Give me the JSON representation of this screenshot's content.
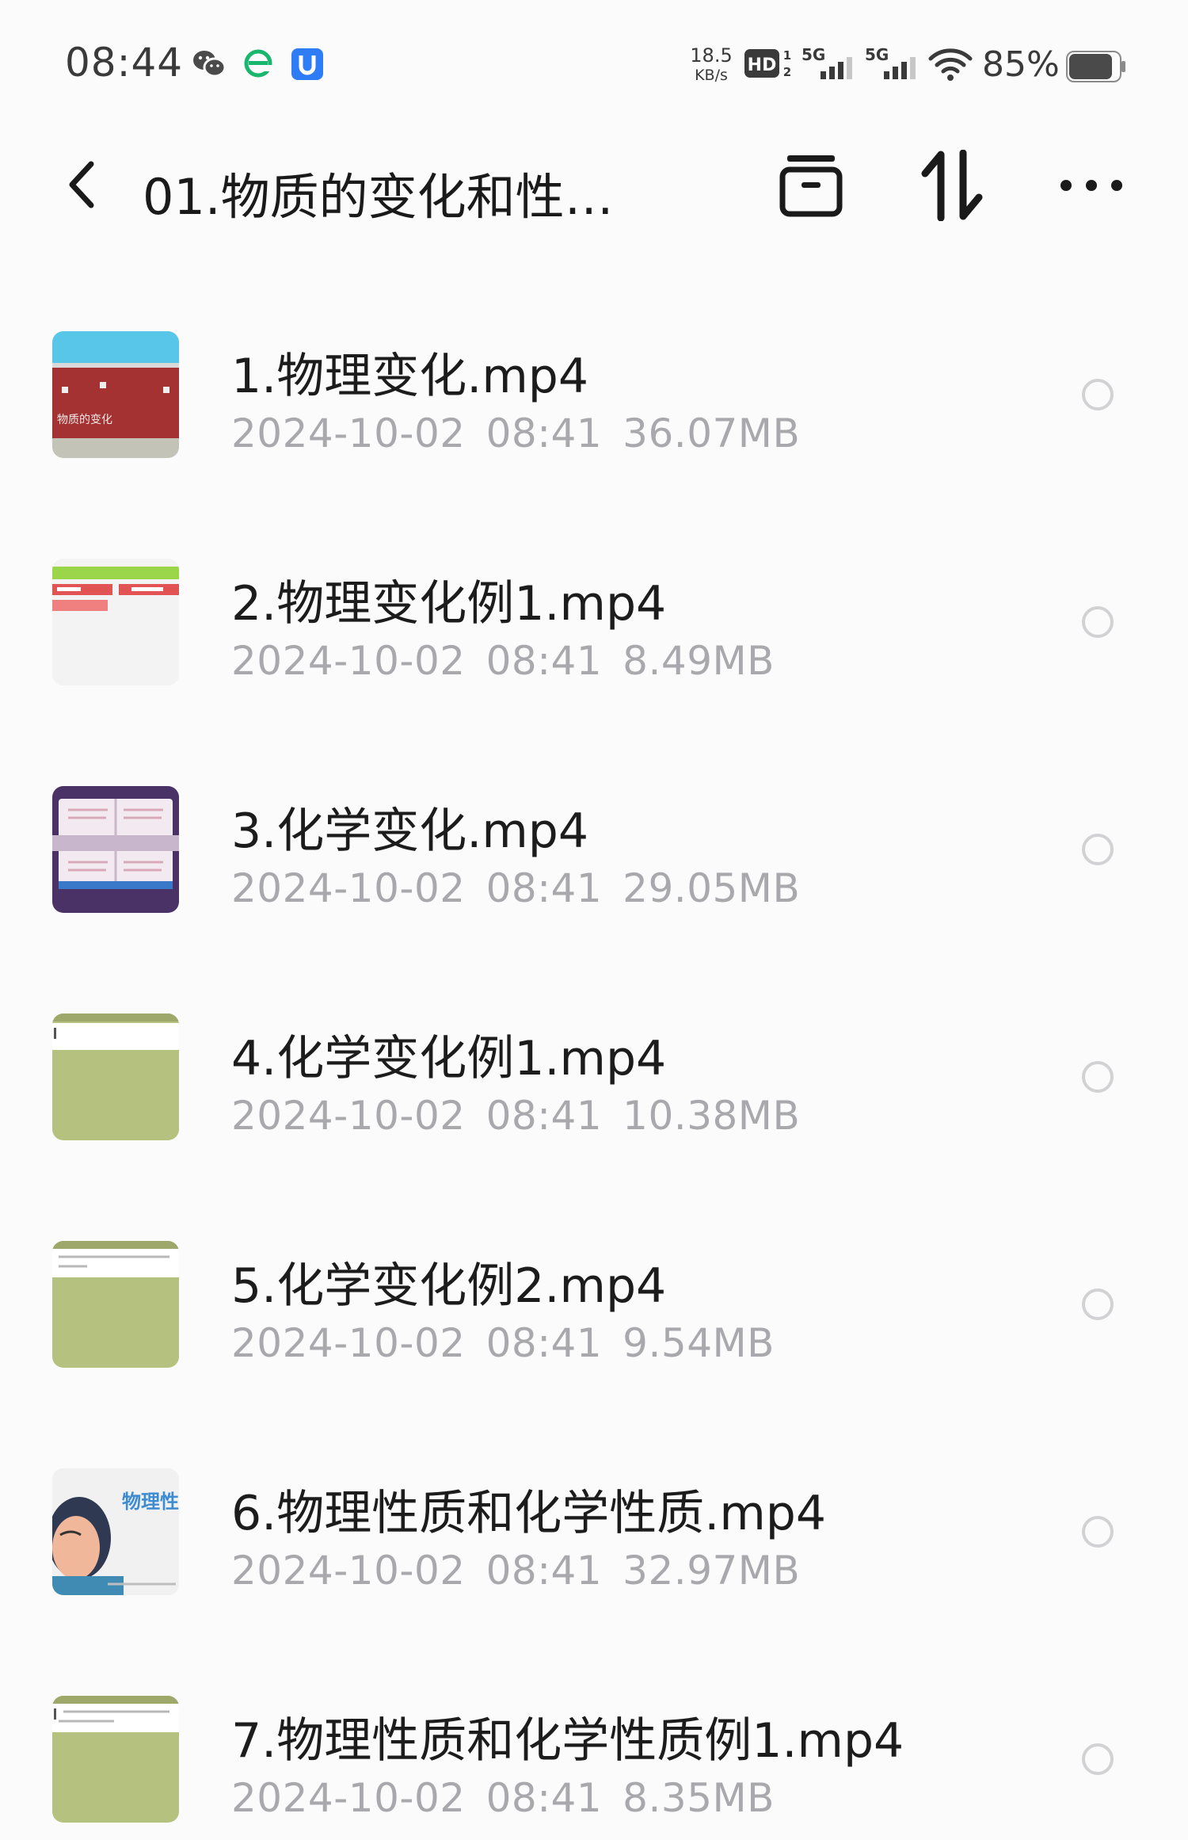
{
  "status_bar": {
    "time": "08:44",
    "net_speed_value": "18.5",
    "net_speed_unit": "KB/s",
    "hd_label": "HD",
    "signal_1_label": "5G",
    "signal_2_label": "5G",
    "battery_percent": "85%",
    "app_icons": [
      "wechat-icon",
      "browser-icon",
      "shield-app-icon"
    ]
  },
  "title_bar": {
    "title": "01.物质的变化和性…",
    "actions": [
      "archive-icon",
      "sort-icon",
      "more-icon"
    ]
  },
  "files": [
    {
      "name": "1.物理变化.mp4",
      "date": "2024-10-02",
      "time": "08:41",
      "size": "36.07MB"
    },
    {
      "name": "2.物理变化例1.mp4",
      "date": "2024-10-02",
      "time": "08:41",
      "size": "8.49MB"
    },
    {
      "name": "3.化学变化.mp4",
      "date": "2024-10-02",
      "time": "08:41",
      "size": "29.05MB"
    },
    {
      "name": "4.化学变化例1.mp4",
      "date": "2024-10-02",
      "time": "08:41",
      "size": "10.38MB"
    },
    {
      "name": "5.化学变化例2.mp4",
      "date": "2024-10-02",
      "time": "08:41",
      "size": "9.54MB"
    },
    {
      "name": "6.物理性质和化学性质.mp4",
      "date": "2024-10-02",
      "time": "08:41",
      "size": "32.97MB"
    },
    {
      "name": "7.物理性质和化学性质例1.mp4",
      "date": "2024-10-02",
      "time": "08:41",
      "size": "8.35MB"
    }
  ],
  "thumbnail_text": {
    "thumb1": "物质的变化",
    "thumb6": "物理性"
  },
  "colors": {
    "accent_icon_blue": "#2f7df6",
    "accent_icon_green": "#19b66e",
    "meta_gray": "#a9a9ad",
    "title_black": "#1a1a1a"
  }
}
